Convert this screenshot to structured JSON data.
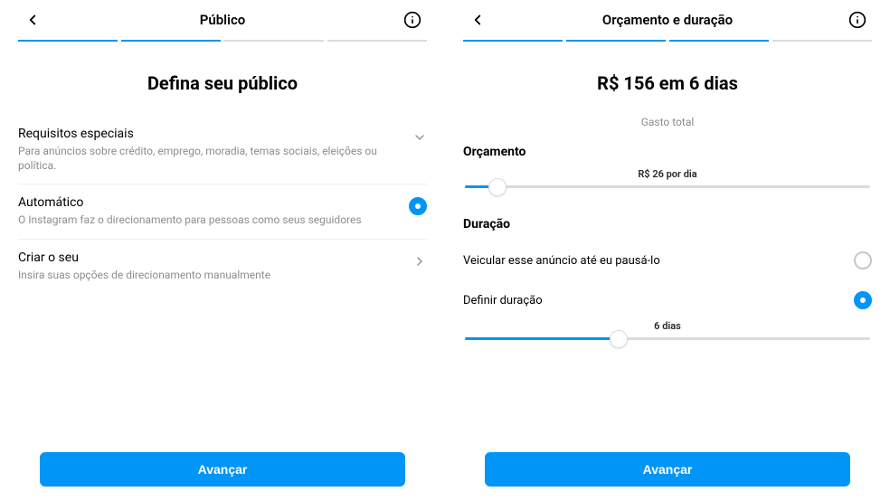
{
  "left": {
    "header_title": "Público",
    "progress": [
      true,
      true,
      false,
      false
    ],
    "main_title": "Defina seu público",
    "options": [
      {
        "title": "Requisitos especiais",
        "desc": "Para anúncios sobre crédito, emprego, moradia, temas sociais, eleições ou política.",
        "type": "chevron-down"
      },
      {
        "title": "Automático",
        "desc": "O Instagram faz o direcionamento para pessoas como seus seguidores",
        "type": "radio",
        "selected": true
      },
      {
        "title": "Criar o seu",
        "desc": "Insira suas opções de direcionamento manualmente",
        "type": "chevron-right"
      }
    ],
    "cta": "Avançar"
  },
  "right": {
    "header_title": "Orçamento e duração",
    "progress": [
      true,
      true,
      true,
      false
    ],
    "main_title": "R$ 156 em 6 dias",
    "spend_sub": "Gasto total",
    "budget_label": "Orçamento",
    "budget_per_day": "R$ 26 por dia",
    "budget_slider_pct": 8,
    "duration_label": "Duração",
    "duration_options": [
      {
        "label": "Veicular esse anúncio até eu pausá-lo",
        "selected": false
      },
      {
        "label": "Definir duração",
        "selected": true
      }
    ],
    "duration_slider_label": "6 dias",
    "duration_slider_pct": 38,
    "cta": "Avançar"
  }
}
